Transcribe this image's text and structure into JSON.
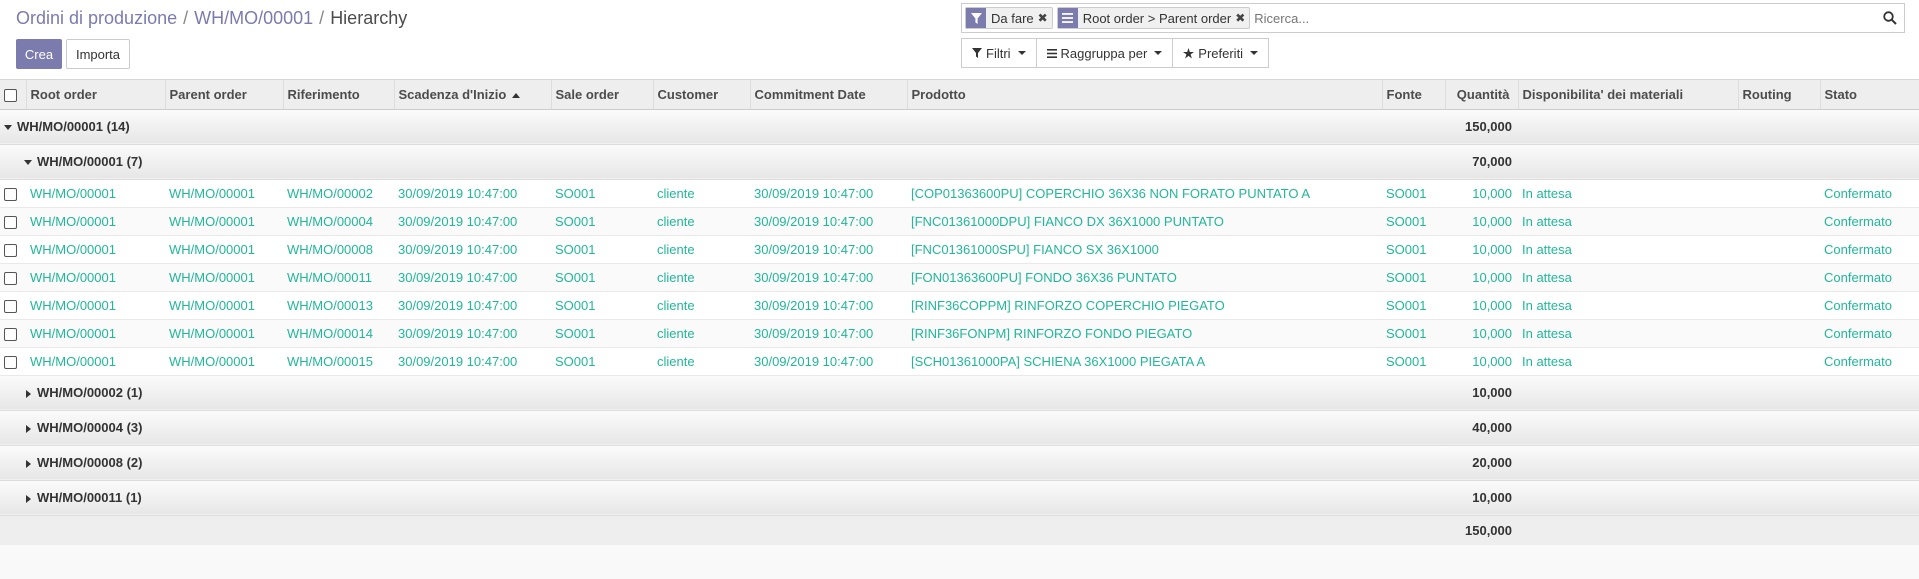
{
  "breadcrumb": {
    "items": [
      "Ordini di produzione",
      "WH/MO/00001"
    ],
    "separator": "/",
    "current": "Hierarchy"
  },
  "buttons": {
    "create": "Crea",
    "import": "Importa"
  },
  "search": {
    "facets": [
      {
        "icon": "filter-icon",
        "label": "Da fare"
      },
      {
        "icon": "group-by-icon",
        "label": "Root order > Parent order"
      }
    ],
    "placeholder": "Ricerca..."
  },
  "search_options": {
    "filters": "Filtri",
    "group_by": "Raggruppa per",
    "favorites": "Preferiti"
  },
  "columns": {
    "root_order": "Root order",
    "parent_order": "Parent order",
    "riferimento": "Riferimento",
    "scadenza": "Scadenza d'Inizio",
    "sale_order": "Sale order",
    "customer": "Customer",
    "commitment": "Commitment Date",
    "prodotto": "Prodotto",
    "fonte": "Fonte",
    "quantita": "Quantità",
    "disponibilita": "Disponibilita' dei materiali",
    "routing": "Routing",
    "stato": "Stato"
  },
  "group_root": {
    "label": "WH/MO/00001 (14)",
    "qty": "150,000"
  },
  "group_open": {
    "label": "WH/MO/00001 (7)",
    "qty": "70,000"
  },
  "rows": [
    {
      "root": "WH/MO/00001",
      "parent": "WH/MO/00001",
      "ref": "WH/MO/00002",
      "date": "30/09/2019 10:47:00",
      "so": "SO001",
      "customer": "cliente",
      "commit": "30/09/2019 10:47:00",
      "product": "[COP01363600PU] COPERCHIO 36X36 NON FORATO PUNTATO A",
      "source": "SO001",
      "qty": "10,000",
      "avail": "In attesa",
      "routing": "",
      "state": "Confermato"
    },
    {
      "root": "WH/MO/00001",
      "parent": "WH/MO/00001",
      "ref": "WH/MO/00004",
      "date": "30/09/2019 10:47:00",
      "so": "SO001",
      "customer": "cliente",
      "commit": "30/09/2019 10:47:00",
      "product": "[FNC01361000DPU] FIANCO DX 36X1000 PUNTATO",
      "source": "SO001",
      "qty": "10,000",
      "avail": "In attesa",
      "routing": "",
      "state": "Confermato"
    },
    {
      "root": "WH/MO/00001",
      "parent": "WH/MO/00001",
      "ref": "WH/MO/00008",
      "date": "30/09/2019 10:47:00",
      "so": "SO001",
      "customer": "cliente",
      "commit": "30/09/2019 10:47:00",
      "product": "[FNC01361000SPU] FIANCO SX 36X1000",
      "source": "SO001",
      "qty": "10,000",
      "avail": "In attesa",
      "routing": "",
      "state": "Confermato"
    },
    {
      "root": "WH/MO/00001",
      "parent": "WH/MO/00001",
      "ref": "WH/MO/00011",
      "date": "30/09/2019 10:47:00",
      "so": "SO001",
      "customer": "cliente",
      "commit": "30/09/2019 10:47:00",
      "product": "[FON01363600PU] FONDO 36X36 PUNTATO",
      "source": "SO001",
      "qty": "10,000",
      "avail": "In attesa",
      "routing": "",
      "state": "Confermato"
    },
    {
      "root": "WH/MO/00001",
      "parent": "WH/MO/00001",
      "ref": "WH/MO/00013",
      "date": "30/09/2019 10:47:00",
      "so": "SO001",
      "customer": "cliente",
      "commit": "30/09/2019 10:47:00",
      "product": "[RINF36COPPM] RINFORZO COPERCHIO PIEGATO",
      "source": "SO001",
      "qty": "10,000",
      "avail": "In attesa",
      "routing": "",
      "state": "Confermato"
    },
    {
      "root": "WH/MO/00001",
      "parent": "WH/MO/00001",
      "ref": "WH/MO/00014",
      "date": "30/09/2019 10:47:00",
      "so": "SO001",
      "customer": "cliente",
      "commit": "30/09/2019 10:47:00",
      "product": "[RINF36FONPM] RINFORZO FONDO PIEGATO",
      "source": "SO001",
      "qty": "10,000",
      "avail": "In attesa",
      "routing": "",
      "state": "Confermato"
    },
    {
      "root": "WH/MO/00001",
      "parent": "WH/MO/00001",
      "ref": "WH/MO/00015",
      "date": "30/09/2019 10:47:00",
      "so": "SO001",
      "customer": "cliente",
      "commit": "30/09/2019 10:47:00",
      "product": "[SCH01361000PA] SCHIENA 36X1000 PIEGATA A",
      "source": "SO001",
      "qty": "10,000",
      "avail": "In attesa",
      "routing": "",
      "state": "Confermato"
    }
  ],
  "collapsed_groups": [
    {
      "label": "WH/MO/00002 (1)",
      "qty": "10,000"
    },
    {
      "label": "WH/MO/00004 (3)",
      "qty": "40,000"
    },
    {
      "label": "WH/MO/00008 (2)",
      "qty": "20,000"
    },
    {
      "label": "WH/MO/00011 (1)",
      "qty": "10,000"
    }
  ],
  "total_qty": "150,000"
}
